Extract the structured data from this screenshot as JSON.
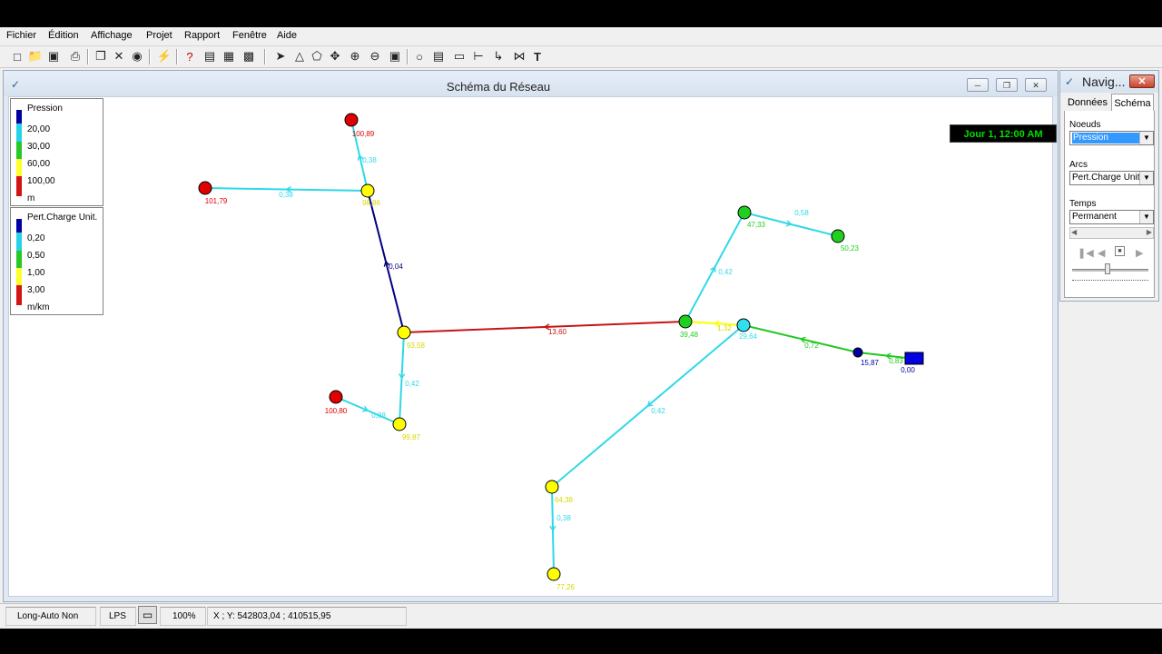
{
  "menu": [
    "Fichier",
    "Édition",
    "Affichage",
    "Projet",
    "Rapport",
    "Fenêtre",
    "Aide"
  ],
  "map_window": {
    "title": "Schéma du Réseau",
    "clock": "Jour 1, 12:00 AM"
  },
  "legend_nodes": {
    "title": "Pression",
    "levels": [
      "20,00",
      "30,00",
      "60,00",
      "100,00"
    ],
    "unit": "m",
    "colors": [
      "#0000a0",
      "#28d2e6",
      "#28c828",
      "#ffff28",
      "#d21414"
    ]
  },
  "legend_links": {
    "title": "Pert.Charge Unit.",
    "levels": [
      "0,20",
      "0,50",
      "1,00",
      "3,00"
    ],
    "unit": "m/km",
    "colors": [
      "#0000a0",
      "#28d2e6",
      "#28c828",
      "#ffff28",
      "#d21414"
    ]
  },
  "network": {
    "nodes": [
      {
        "id": "n1",
        "label": "100,89",
        "color": "#e00000"
      },
      {
        "id": "n2",
        "label": "101,79",
        "color": "#e00000"
      },
      {
        "id": "n3",
        "label": "98,86",
        "color": "#ffff00"
      },
      {
        "id": "n4",
        "label": "93,58",
        "color": "#ffff00"
      },
      {
        "id": "n5",
        "label": "100,80",
        "color": "#e00000"
      },
      {
        "id": "n6",
        "label": "99,87",
        "color": "#ffff00"
      },
      {
        "id": "n7",
        "label": "47,33",
        "color": "#20d020"
      },
      {
        "id": "n8",
        "label": "50,23",
        "color": "#20d020"
      },
      {
        "id": "n9",
        "label": "39,48",
        "color": "#20d020"
      },
      {
        "id": "n10",
        "label": "29,64",
        "color": "#30e0f0"
      },
      {
        "id": "n11",
        "label": "15,87",
        "color": "#0000a0"
      },
      {
        "id": "n12",
        "label": "64,38",
        "color": "#ffff00"
      },
      {
        "id": "n13",
        "label": "77,26",
        "color": "#ffff00"
      },
      {
        "id": "reservoir",
        "label": "0,00",
        "color": "#0000e0"
      }
    ],
    "links": [
      {
        "label": "0,38",
        "color": "#30d8e8"
      },
      {
        "label": "0,38",
        "color": "#30d8e8"
      },
      {
        "label": "0,04",
        "color": "#000080"
      },
      {
        "label": "13,60",
        "color": "#c81414"
      },
      {
        "label": "0,42",
        "color": "#30d8e8"
      },
      {
        "label": "0,38",
        "color": "#30d8e8"
      },
      {
        "label": "0,42",
        "color": "#30d8e8"
      },
      {
        "label": "0,58",
        "color": "#30d8e8"
      },
      {
        "label": "1,32",
        "color": "#ffff00"
      },
      {
        "label": "0,72",
        "color": "#20c820"
      },
      {
        "label": "0,83",
        "color": "#20c820"
      },
      {
        "label": "0,42",
        "color": "#30d8e8"
      },
      {
        "label": "0,38",
        "color": "#30d8e8"
      }
    ]
  },
  "navigator": {
    "title": "Navig...",
    "tabs": [
      "Données",
      "Schéma"
    ],
    "nodes_label": "Noeuds",
    "nodes_value": "Pression",
    "links_label": "Arcs",
    "links_value": "Pert.Charge Unit",
    "time_label": "Temps",
    "time_value": "Permanent"
  },
  "status": {
    "auto_length": "Long-Auto  Non",
    "flow_units": "LPS",
    "zoom": "100%",
    "coords": "X ; Y: 542803,04 ;  410515,95"
  }
}
